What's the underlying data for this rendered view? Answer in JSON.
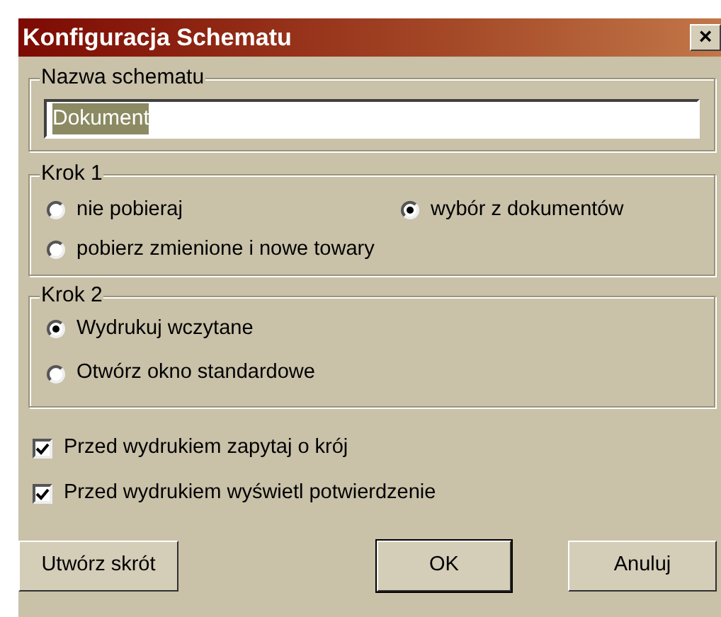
{
  "window": {
    "title": "Konfiguracja Schematu",
    "close": "×"
  },
  "name_group": {
    "label": "Nazwa schematu",
    "field": {
      "value": "Dokument",
      "text_selected": true
    }
  },
  "step1": {
    "label": "Krok 1",
    "options": [
      {
        "label": "nie pobieraj",
        "selected": false
      },
      {
        "label": "wybór z dokumentów",
        "selected": true
      },
      {
        "label": "pobierz zmienione i nowe towary",
        "selected": false
      }
    ]
  },
  "step2": {
    "label": "Krok 2",
    "options": [
      {
        "label": "Wydrukuj wczytane",
        "selected": true
      },
      {
        "label": "Otwórz okno standardowe",
        "selected": false
      }
    ]
  },
  "checkboxes": [
    {
      "label": "Przed wydrukiem zapytaj o krój",
      "checked": true
    },
    {
      "label": "Przed wydrukiem wyświetl potwierdzenie",
      "checked": true
    }
  ],
  "buttons": [
    {
      "label": "Utwórz skrót",
      "default": false
    },
    {
      "label": "OK",
      "default": true
    },
    {
      "label": "Anuluj",
      "default": false
    }
  ]
}
